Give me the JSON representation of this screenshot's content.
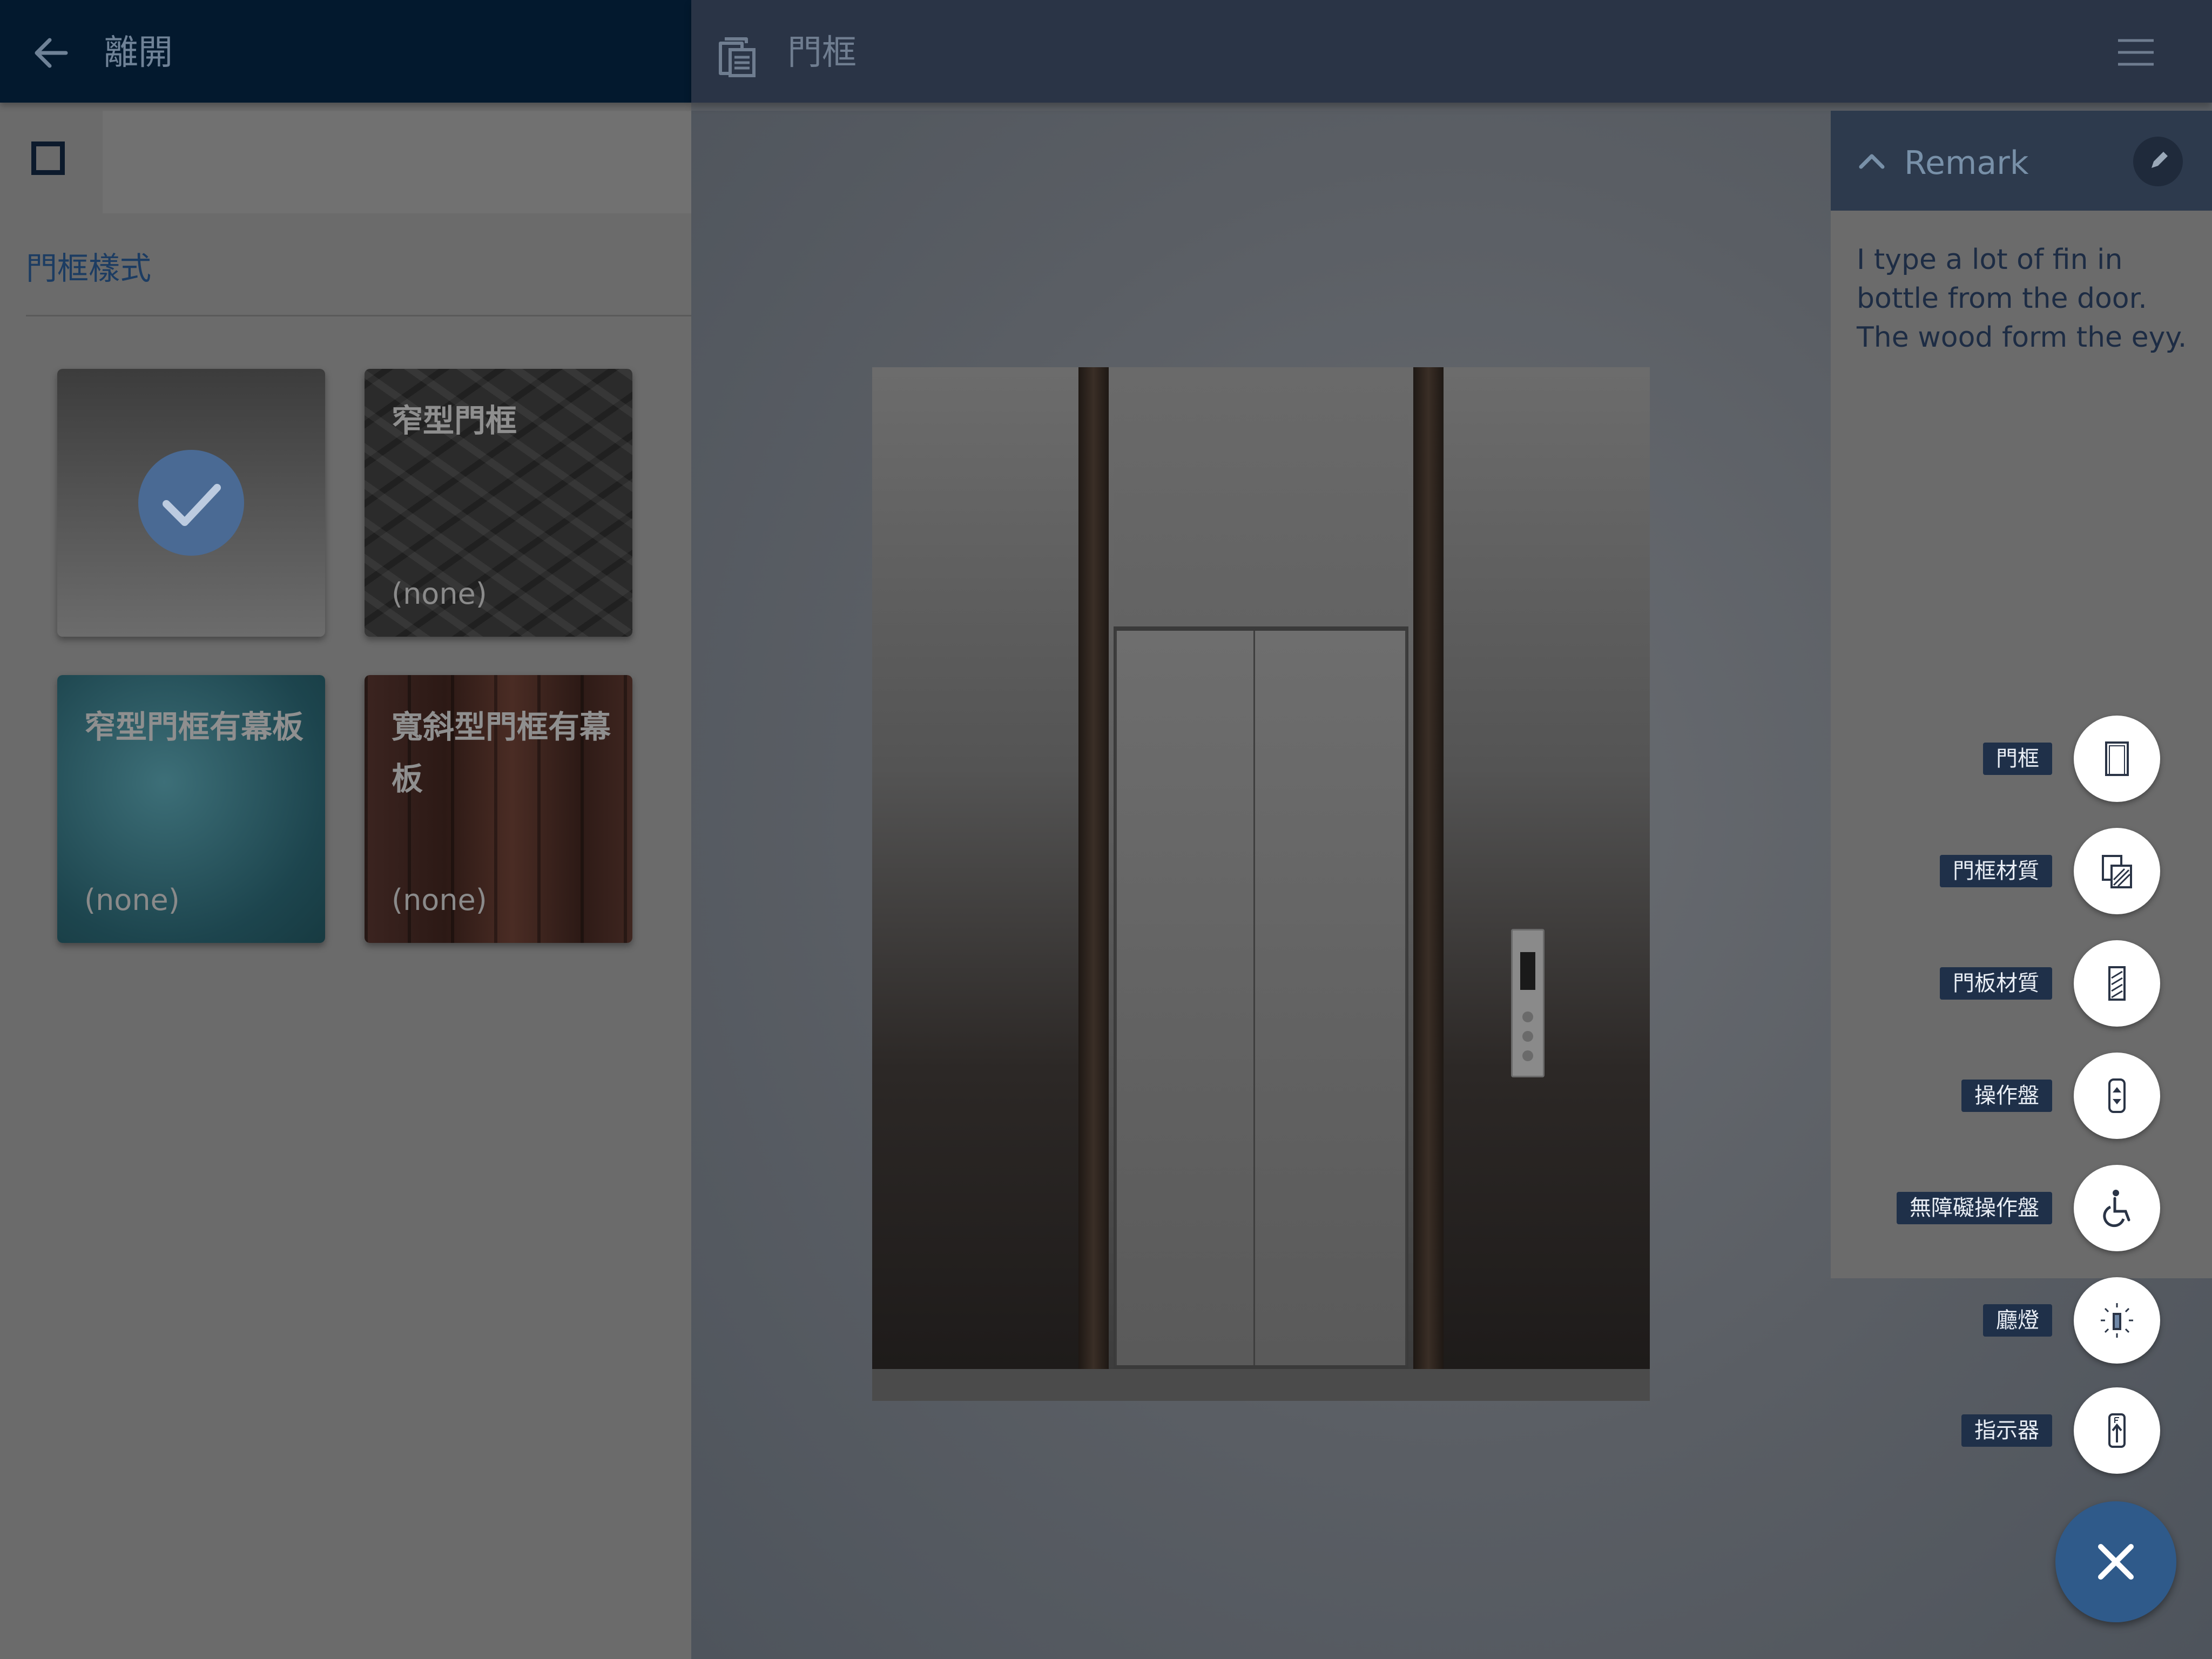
{
  "left_panel": {
    "header": {
      "back_label": "離開"
    },
    "section_title": "門框樣式",
    "tiles": [
      {
        "label": "",
        "sub": "",
        "selected": true
      },
      {
        "label": "窄型門框",
        "sub": "(none)"
      },
      {
        "label": "窄型門框有幕板",
        "sub": "(none)"
      },
      {
        "label": "寬斜型門框有幕板",
        "sub": "(none)"
      }
    ]
  },
  "main_header": {
    "title": "門框"
  },
  "remark": {
    "title": "Remark",
    "text": "I type a lot of fin in bottle from the door. The wood form the eyy."
  },
  "fab_menu": {
    "items": [
      {
        "label": "門框",
        "icon": "door-frame-icon"
      },
      {
        "label": "門框材質",
        "icon": "frame-material-icon"
      },
      {
        "label": "門板材質",
        "icon": "door-panel-material-icon"
      },
      {
        "label": "操作盤",
        "icon": "control-panel-icon"
      },
      {
        "label": "無障礙操作盤",
        "icon": "wheelchair-icon"
      },
      {
        "label": "廳燈",
        "icon": "hall-lantern-icon"
      },
      {
        "label": "指示器",
        "icon": "indicator-icon"
      }
    ],
    "close_icon": "close-icon"
  },
  "colors": {
    "header_dark": "#03192e",
    "header_main": "#2a3446",
    "label_bg": "#1f3049",
    "fab_close": "#2f5a8a",
    "check": "#4a6a94"
  }
}
